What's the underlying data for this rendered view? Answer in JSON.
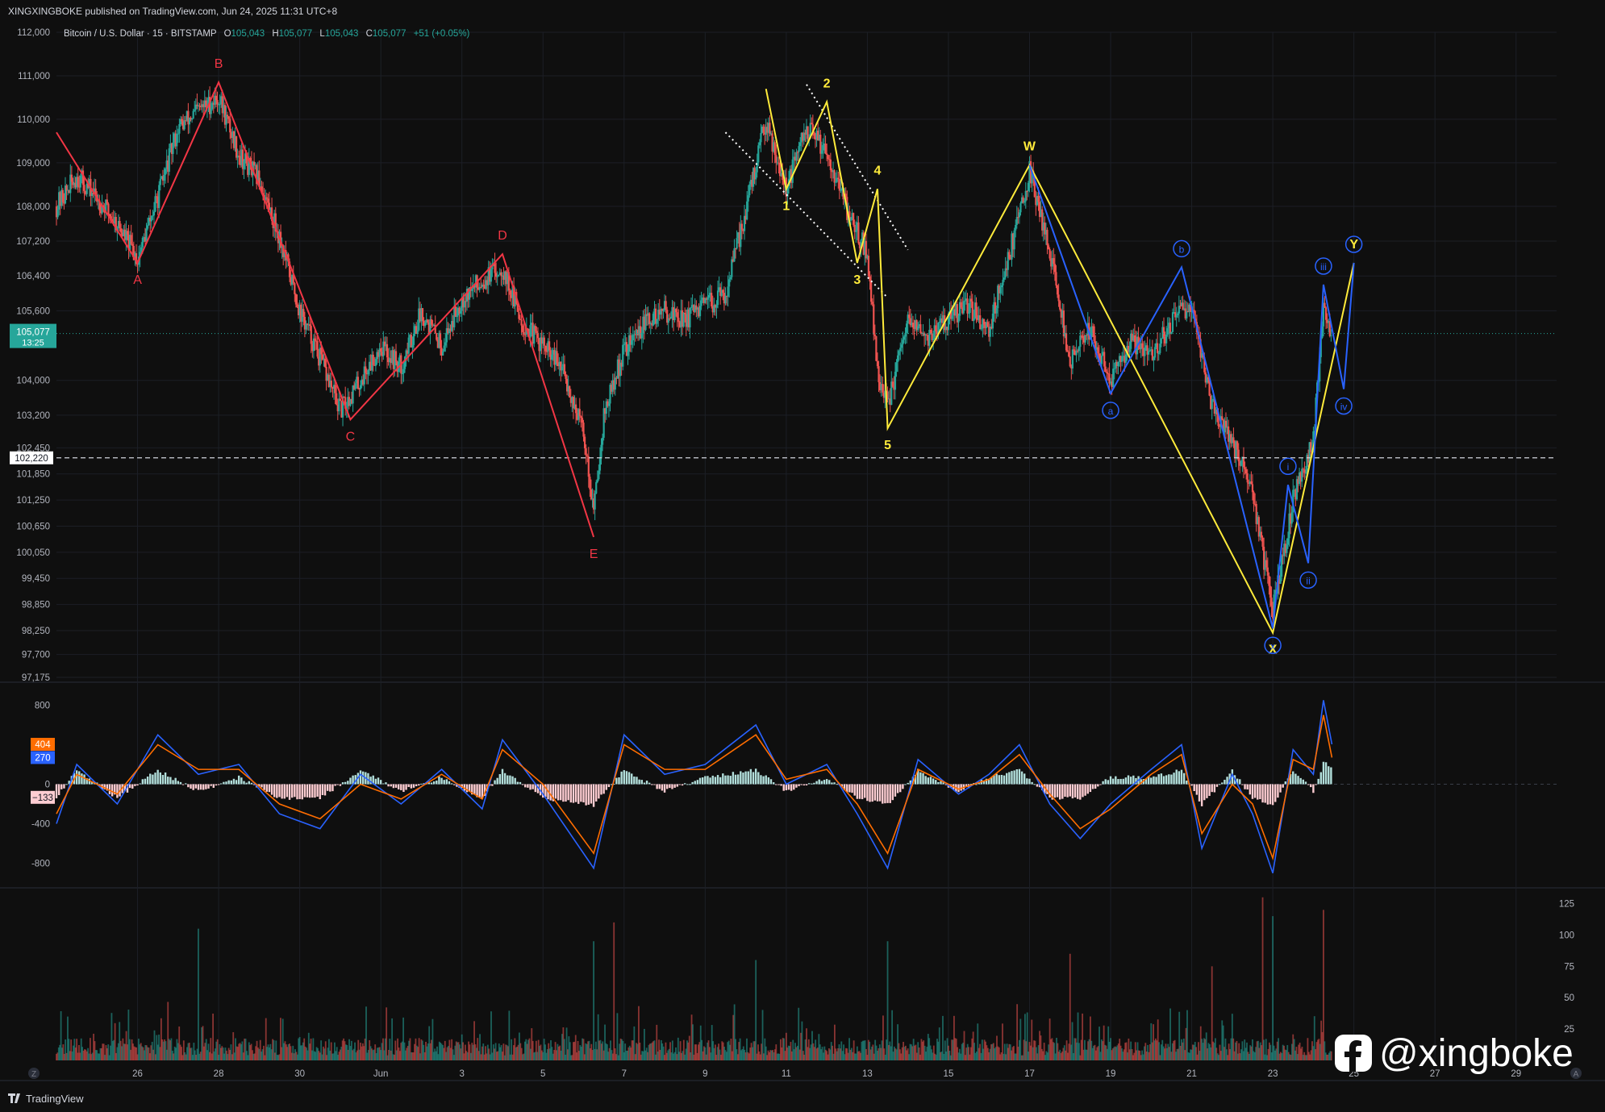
{
  "header": {
    "publisher_line": "XINGXINGBOKE published on TradingView.com, Jun 24, 2025 11:31 UTC+8",
    "symbol": "Bitcoin / U.S. Dollar · 15 · BITSTAMP",
    "ohlc": [
      {
        "k": "O",
        "v": "105,043"
      },
      {
        "k": "H",
        "v": "105,077"
      },
      {
        "k": "L",
        "v": "105,043"
      },
      {
        "k": "C",
        "v": "105,077"
      }
    ],
    "change": "+51 (+0.05%)"
  },
  "footer": {
    "brand": "TradingView",
    "watermark": "@xingboke",
    "scale_mode_label": "Z",
    "auto_label": "A"
  },
  "colors": {
    "background": "#0f0f0f",
    "up": "#26a69a",
    "down": "#ef5350",
    "red_wave": "#f23645",
    "yellow_wave": "#ffeb3b",
    "blue_wave": "#2962ff",
    "macd_line": "#2962ff",
    "signal_line": "#ff6d00"
  },
  "chart_data": [
    {
      "type": "candlestick",
      "title": "Bitcoin / U.S. Dollar · 15 · BITSTAMP",
      "x_ticks": [
        "26",
        "28",
        "30",
        "Jun",
        "3",
        "5",
        "7",
        "9",
        "11",
        "13",
        "15",
        "17",
        "19",
        "21",
        "23",
        "25",
        "27",
        "29"
      ],
      "x_range": [
        "2025-05-24",
        "2025-06-30"
      ],
      "ylim": [
        97175,
        112000
      ],
      "y_ticks": [
        "112,000",
        "111,000",
        "110,000",
        "109,000",
        "108,000",
        "107,200",
        "106,400",
        "105,600",
        "104,000",
        "103,200",
        "102,450",
        "101,850",
        "101,250",
        "100,650",
        "100,050",
        "99,450",
        "98,850",
        "98,250",
        "97,700",
        "97,175"
      ],
      "last_price": {
        "value": 105077,
        "label": "105,077",
        "countdown": "13:25"
      },
      "horizontal_line": {
        "value": 102220,
        "label": "102,220"
      },
      "price_path": [
        {
          "t": "2025-05-24T00:00",
          "p": 108000
        },
        {
          "t": "2025-05-24T12:00",
          "p": 108700
        },
        {
          "t": "2025-05-25T00:00",
          "p": 108200
        },
        {
          "t": "2025-05-25T12:00",
          "p": 107600
        },
        {
          "t": "2025-05-26T00:00",
          "p": 106800
        },
        {
          "t": "2025-05-26T12:00",
          "p": 108200
        },
        {
          "t": "2025-05-27T00:00",
          "p": 109800
        },
        {
          "t": "2025-05-27T12:00",
          "p": 110200
        },
        {
          "t": "2025-05-28T00:00",
          "p": 110500
        },
        {
          "t": "2025-05-28T12:00",
          "p": 109200
        },
        {
          "t": "2025-05-29T00:00",
          "p": 108600
        },
        {
          "t": "2025-05-29T12:00",
          "p": 107300
        },
        {
          "t": "2025-05-30T00:00",
          "p": 105600
        },
        {
          "t": "2025-05-30T12:00",
          "p": 104500
        },
        {
          "t": "2025-05-31T00:00",
          "p": 103300
        },
        {
          "t": "2025-05-31T12:00",
          "p": 104000
        },
        {
          "t": "2025-06-01T00:00",
          "p": 104800
        },
        {
          "t": "2025-06-01T12:00",
          "p": 104300
        },
        {
          "t": "2025-06-02T00:00",
          "p": 105600
        },
        {
          "t": "2025-06-02T12:00",
          "p": 104800
        },
        {
          "t": "2025-06-03T00:00",
          "p": 105900
        },
        {
          "t": "2025-06-03T12:00",
          "p": 106300
        },
        {
          "t": "2025-06-04T00:00",
          "p": 106600
        },
        {
          "t": "2025-06-04T12:00",
          "p": 105300
        },
        {
          "t": "2025-06-05T00:00",
          "p": 104800
        },
        {
          "t": "2025-06-05T12:00",
          "p": 104200
        },
        {
          "t": "2025-06-06T00:00",
          "p": 102800
        },
        {
          "t": "2025-06-06T06:00",
          "p": 101000
        },
        {
          "t": "2025-06-06T12:00",
          "p": 103200
        },
        {
          "t": "2025-06-07T00:00",
          "p": 104700
        },
        {
          "t": "2025-06-07T12:00",
          "p": 105300
        },
        {
          "t": "2025-06-08T00:00",
          "p": 105600
        },
        {
          "t": "2025-06-08T12:00",
          "p": 105400
        },
        {
          "t": "2025-06-09T00:00",
          "p": 105700
        },
        {
          "t": "2025-06-09T12:00",
          "p": 106000
        },
        {
          "t": "2025-06-10T00:00",
          "p": 107900
        },
        {
          "t": "2025-06-10T12:00",
          "p": 110000
        },
        {
          "t": "2025-06-11T00:00",
          "p": 108400
        },
        {
          "t": "2025-06-11T12:00",
          "p": 109800
        },
        {
          "t": "2025-06-12T00:00",
          "p": 109300
        },
        {
          "t": "2025-06-12T12:00",
          "p": 107900
        },
        {
          "t": "2025-06-13T00:00",
          "p": 106900
        },
        {
          "t": "2025-06-13T06:00",
          "p": 104200
        },
        {
          "t": "2025-06-13T12:00",
          "p": 103400
        },
        {
          "t": "2025-06-14T00:00",
          "p": 105300
        },
        {
          "t": "2025-06-14T12:00",
          "p": 105000
        },
        {
          "t": "2025-06-15T00:00",
          "p": 105400
        },
        {
          "t": "2025-06-15T12:00",
          "p": 105700
        },
        {
          "t": "2025-06-16T00:00",
          "p": 105200
        },
        {
          "t": "2025-06-16T12:00",
          "p": 106900
        },
        {
          "t": "2025-06-17T00:00",
          "p": 108800
        },
        {
          "t": "2025-06-17T12:00",
          "p": 107000
        },
        {
          "t": "2025-06-18T00:00",
          "p": 104400
        },
        {
          "t": "2025-06-18T12:00",
          "p": 105200
        },
        {
          "t": "2025-06-19T00:00",
          "p": 104000
        },
        {
          "t": "2025-06-19T12:00",
          "p": 104900
        },
        {
          "t": "2025-06-20T00:00",
          "p": 104600
        },
        {
          "t": "2025-06-20T12:00",
          "p": 105300
        },
        {
          "t": "2025-06-21T00:00",
          "p": 105800
        },
        {
          "t": "2025-06-21T12:00",
          "p": 103400
        },
        {
          "t": "2025-06-22T00:00",
          "p": 102600
        },
        {
          "t": "2025-06-22T12:00",
          "p": 101400
        },
        {
          "t": "2025-06-23T00:00",
          "p": 98700
        },
        {
          "t": "2025-06-23T06:00",
          "p": 99900
        },
        {
          "t": "2025-06-23T12:00",
          "p": 101300
        },
        {
          "t": "2025-06-24T00:00",
          "p": 102600
        },
        {
          "t": "2025-06-24T06:00",
          "p": 105800
        },
        {
          "t": "2025-06-24T11:00",
          "p": 105077
        }
      ],
      "wave_annotations": [
        {
          "name": "red",
          "color": "#f23645",
          "points": [
            {
              "t": "2025-05-24T00:00",
              "p": 109700,
              "label": ""
            },
            {
              "t": "2025-05-26T00:00",
              "p": 106700,
              "label": "A"
            },
            {
              "t": "2025-05-28T00:00",
              "p": 110850,
              "label": "B"
            },
            {
              "t": "2025-05-31T06:00",
              "p": 103100,
              "label": "C"
            },
            {
              "t": "2025-06-04T00:00",
              "p": 106900,
              "label": "D"
            },
            {
              "t": "2025-06-06T06:00",
              "p": 100400,
              "label": "E"
            }
          ]
        },
        {
          "name": "yellow",
          "color": "#ffeb3b",
          "points": [
            {
              "t": "2025-06-10T12:00",
              "p": 110700,
              "label": ""
            },
            {
              "t": "2025-06-11T00:00",
              "p": 108400,
              "label": "1"
            },
            {
              "t": "2025-06-12T00:00",
              "p": 110400,
              "label": "2"
            },
            {
              "t": "2025-06-12T18:00",
              "p": 106700,
              "label": "3"
            },
            {
              "t": "2025-06-13T06:00",
              "p": 108400,
              "label": "4"
            },
            {
              "t": "2025-06-13T12:00",
              "p": 102900,
              "label": "5"
            },
            {
              "t": "2025-06-17T00:00",
              "p": 108950,
              "label": "W"
            },
            {
              "t": "2025-06-23T00:00",
              "p": 98200,
              "label": "X"
            },
            {
              "t": "2025-06-25T00:00",
              "p": 106700,
              "label": "Y"
            }
          ]
        },
        {
          "name": "blue",
          "color": "#2962ff",
          "points": [
            {
              "t": "2025-06-17T00:00",
              "p": 108950,
              "label": ""
            },
            {
              "t": "2025-06-19T00:00",
              "p": 103700,
              "label": "a"
            },
            {
              "t": "2025-06-20T18:00",
              "p": 106600,
              "label": "b"
            },
            {
              "t": "2025-06-23T00:00",
              "p": 98300,
              "label": "x"
            },
            {
              "t": "2025-06-23T09:00",
              "p": 101600,
              "label": "i"
            },
            {
              "t": "2025-06-23T21:00",
              "p": 99800,
              "label": "ii"
            },
            {
              "t": "2025-06-24T06:00",
              "p": 106200,
              "label": "iii"
            },
            {
              "t": "2025-06-24T18:00",
              "p": 103800,
              "label": "iv"
            },
            {
              "t": "2025-06-25T00:00",
              "p": 106700,
              "label": ""
            }
          ]
        }
      ],
      "trend_channel": [
        {
          "from": {
            "t": "2025-06-09T12:00",
            "p": 109700
          },
          "to": {
            "t": "2025-06-13T12:00",
            "p": 105900
          }
        },
        {
          "from": {
            "t": "2025-06-11T12:00",
            "p": 110800
          },
          "to": {
            "t": "2025-06-14T00:00",
            "p": 107000
          }
        }
      ]
    },
    {
      "type": "macd",
      "ylim": [
        -1000,
        1000
      ],
      "y_ticks": [
        "800",
        "0",
        "-400",
        "-800"
      ],
      "last_values": [
        {
          "name": "macd",
          "value": 404,
          "label": "404"
        },
        {
          "name": "signal",
          "value": 270,
          "label": "270"
        },
        {
          "name": "histogram",
          "value": -133,
          "label": "−133"
        }
      ],
      "series": [
        {
          "name": "macd",
          "points": [
            {
              "t": "2025-05-24T00:00",
              "v": -400
            },
            {
              "t": "2025-05-24T12:00",
              "v": 200
            },
            {
              "t": "2025-05-25T12:00",
              "v": -200
            },
            {
              "t": "2025-05-26T12:00",
              "v": 500
            },
            {
              "t": "2025-05-27T12:00",
              "v": 100
            },
            {
              "t": "2025-05-28T12:00",
              "v": 200
            },
            {
              "t": "2025-05-29T12:00",
              "v": -300
            },
            {
              "t": "2025-05-30T12:00",
              "v": -450
            },
            {
              "t": "2025-05-31T12:00",
              "v": 100
            },
            {
              "t": "2025-06-01T12:00",
              "v": -200
            },
            {
              "t": "2025-06-02T12:00",
              "v": 150
            },
            {
              "t": "2025-06-03T12:00",
              "v": -250
            },
            {
              "t": "2025-06-04T00:00",
              "v": 450
            },
            {
              "t": "2025-06-05T00:00",
              "v": -100
            },
            {
              "t": "2025-06-06T06:00",
              "v": -850
            },
            {
              "t": "2025-06-07T00:00",
              "v": 500
            },
            {
              "t": "2025-06-08T00:00",
              "v": 100
            },
            {
              "t": "2025-06-09T00:00",
              "v": 200
            },
            {
              "t": "2025-06-10T06:00",
              "v": 600
            },
            {
              "t": "2025-06-11T00:00",
              "v": 0
            },
            {
              "t": "2025-06-12T00:00",
              "v": 200
            },
            {
              "t": "2025-06-12T18:00",
              "v": -300
            },
            {
              "t": "2025-06-13T12:00",
              "v": -850
            },
            {
              "t": "2025-06-14T06:00",
              "v": 250
            },
            {
              "t": "2025-06-15T06:00",
              "v": -100
            },
            {
              "t": "2025-06-16T00:00",
              "v": 100
            },
            {
              "t": "2025-06-16T18:00",
              "v": 400
            },
            {
              "t": "2025-06-17T12:00",
              "v": -200
            },
            {
              "t": "2025-06-18T06:00",
              "v": -550
            },
            {
              "t": "2025-06-19T00:00",
              "v": -200
            },
            {
              "t": "2025-06-20T00:00",
              "v": 150
            },
            {
              "t": "2025-06-20T18:00",
              "v": 400
            },
            {
              "t": "2025-06-21T06:00",
              "v": -650
            },
            {
              "t": "2025-06-22T00:00",
              "v": 100
            },
            {
              "t": "2025-06-22T12:00",
              "v": -300
            },
            {
              "t": "2025-06-23T00:00",
              "v": -900
            },
            {
              "t": "2025-06-23T12:00",
              "v": 350
            },
            {
              "t": "2025-06-24T00:00",
              "v": 100
            },
            {
              "t": "2025-06-24T06:00",
              "v": 850
            },
            {
              "t": "2025-06-24T11:00",
              "v": 404
            }
          ]
        },
        {
          "name": "signal",
          "points": [
            {
              "t": "2025-05-24T00:00",
              "v": -300
            },
            {
              "t": "2025-05-24T12:00",
              "v": 100
            },
            {
              "t": "2025-05-25T12:00",
              "v": -100
            },
            {
              "t": "2025-05-26T12:00",
              "v": 400
            },
            {
              "t": "2025-05-27T12:00",
              "v": 150
            },
            {
              "t": "2025-05-28T12:00",
              "v": 150
            },
            {
              "t": "2025-05-29T12:00",
              "v": -200
            },
            {
              "t": "2025-05-30T12:00",
              "v": -350
            },
            {
              "t": "2025-05-31T12:00",
              "v": 0
            },
            {
              "t": "2025-06-01T12:00",
              "v": -150
            },
            {
              "t": "2025-06-02T12:00",
              "v": 100
            },
            {
              "t": "2025-06-03T12:00",
              "v": -150
            },
            {
              "t": "2025-06-04T00:00",
              "v": 350
            },
            {
              "t": "2025-06-05T00:00",
              "v": 0
            },
            {
              "t": "2025-06-06T06:00",
              "v": -700
            },
            {
              "t": "2025-06-07T00:00",
              "v": 400
            },
            {
              "t": "2025-06-08T00:00",
              "v": 150
            },
            {
              "t": "2025-06-09T00:00",
              "v": 150
            },
            {
              "t": "2025-06-10T06:00",
              "v": 500
            },
            {
              "t": "2025-06-11T00:00",
              "v": 50
            },
            {
              "t": "2025-06-12T00:00",
              "v": 150
            },
            {
              "t": "2025-06-12T18:00",
              "v": -200
            },
            {
              "t": "2025-06-13T12:00",
              "v": -700
            },
            {
              "t": "2025-06-14T06:00",
              "v": 150
            },
            {
              "t": "2025-06-15T06:00",
              "v": -50
            },
            {
              "t": "2025-06-16T00:00",
              "v": 50
            },
            {
              "t": "2025-06-16T18:00",
              "v": 300
            },
            {
              "t": "2025-06-17T12:00",
              "v": -100
            },
            {
              "t": "2025-06-18T06:00",
              "v": -450
            },
            {
              "t": "2025-06-19T00:00",
              "v": -250
            },
            {
              "t": "2025-06-20T00:00",
              "v": 100
            },
            {
              "t": "2025-06-20T18:00",
              "v": 300
            },
            {
              "t": "2025-06-21T06:00",
              "v": -500
            },
            {
              "t": "2025-06-22T00:00",
              "v": 0
            },
            {
              "t": "2025-06-22T12:00",
              "v": -200
            },
            {
              "t": "2025-06-23T00:00",
              "v": -750
            },
            {
              "t": "2025-06-23T12:00",
              "v": 250
            },
            {
              "t": "2025-06-24T00:00",
              "v": 150
            },
            {
              "t": "2025-06-24T06:00",
              "v": 700
            },
            {
              "t": "2025-06-24T11:00",
              "v": 270
            }
          ]
        }
      ]
    },
    {
      "type": "bar",
      "subtype": "volume",
      "ylim": [
        0,
        135
      ],
      "y_ticks": [
        "125",
        "100",
        "75",
        "50",
        "25"
      ],
      "peaks": [
        {
          "t": "2025-05-27T12:00",
          "v": 105
        },
        {
          "t": "2025-06-06T06:00",
          "v": 95
        },
        {
          "t": "2025-06-06T18:00",
          "v": 110
        },
        {
          "t": "2025-06-10T06:00",
          "v": 80
        },
        {
          "t": "2025-06-13T12:00",
          "v": 95
        },
        {
          "t": "2025-06-18T00:00",
          "v": 85
        },
        {
          "t": "2025-06-21T12:00",
          "v": 75
        },
        {
          "t": "2025-06-22T18:00",
          "v": 130
        },
        {
          "t": "2025-06-23T00:00",
          "v": 115
        },
        {
          "t": "2025-06-24T06:00",
          "v": 120
        }
      ]
    }
  ]
}
